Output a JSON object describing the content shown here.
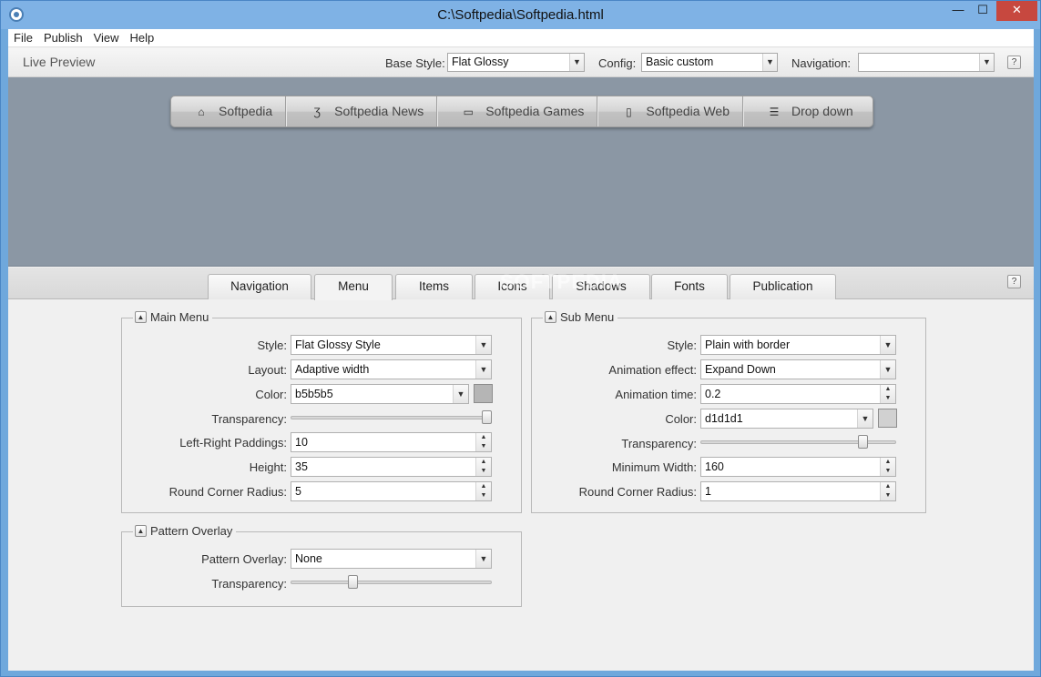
{
  "window": {
    "title": "C:\\Softpedia\\Softpedia.html",
    "minimize": "—",
    "maximize": "☐",
    "close": "✕"
  },
  "menubar": {
    "items": [
      "File",
      "Publish",
      "View",
      "Help"
    ]
  },
  "toolbar": {
    "live_preview": "Live Preview",
    "base_style_label": "Base Style:",
    "base_style_value": "Flat Glossy",
    "config_label": "Config:",
    "config_value": "Basic custom",
    "navigation_label": "Navigation:",
    "navigation_value": "",
    "help": "?"
  },
  "preview_menu": {
    "items": [
      {
        "label": "Softpedia",
        "icon": "home-icon",
        "glyph": "⌂"
      },
      {
        "label": "Softpedia News",
        "icon": "css3-icon",
        "glyph": "Ʒ"
      },
      {
        "label": "Softpedia Games",
        "icon": "monitor-icon",
        "glyph": "▭"
      },
      {
        "label": "Softpedia Web",
        "icon": "mobile-icon",
        "glyph": "▯"
      },
      {
        "label": "Drop down",
        "icon": "list-icon",
        "glyph": "☰"
      }
    ]
  },
  "tabs": [
    "Navigation",
    "Menu",
    "Items",
    "Icons",
    "Shadows",
    "Fonts",
    "Publication"
  ],
  "active_tab": "Menu",
  "watermark": "SOFTPEDIA",
  "main_menu": {
    "title": "Main Menu",
    "style_label": "Style:",
    "style_value": "Flat Glossy Style",
    "layout_label": "Layout:",
    "layout_value": "Adaptive width",
    "color_label": "Color:",
    "color_value": "b5b5b5",
    "color_hex": "#b5b5b5",
    "transparency_label": "Transparency:",
    "transparency": 1.0,
    "paddings_label": "Left-Right Paddings:",
    "paddings_value": "10",
    "height_label": "Height:",
    "height_value": "35",
    "radius_label": "Round Corner Radius:",
    "radius_value": "5"
  },
  "sub_menu": {
    "title": "Sub Menu",
    "style_label": "Style:",
    "style_value": "Plain with border",
    "animation_label": "Animation effect:",
    "animation_value": "Expand Down",
    "anim_time_label": "Animation time:",
    "anim_time_value": "0.2",
    "color_label": "Color:",
    "color_value": "d1d1d1",
    "color_hex": "#d1d1d1",
    "transparency_label": "Transparency:",
    "transparency": 0.85,
    "min_width_label": "Minimum Width:",
    "min_width_value": "160",
    "radius_label": "Round Corner Radius:",
    "radius_value": "1"
  },
  "pattern_overlay": {
    "title": "Pattern Overlay",
    "overlay_label": "Pattern Overlay:",
    "overlay_value": "None",
    "transparency_label": "Transparency:",
    "transparency": 0.3
  }
}
